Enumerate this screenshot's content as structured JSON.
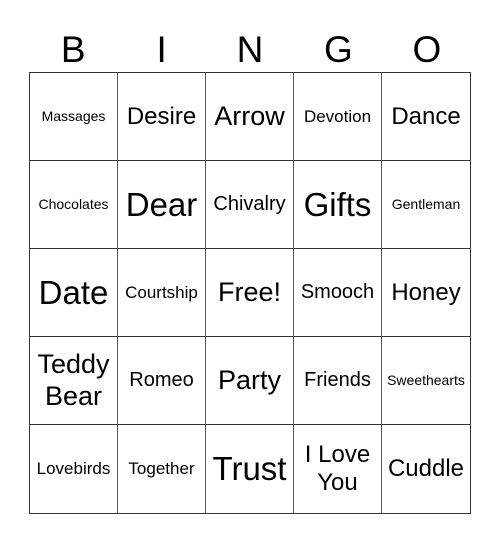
{
  "header": {
    "letters": [
      "B",
      "I",
      "N",
      "G",
      "O"
    ]
  },
  "card": {
    "cells": [
      {
        "text": "Massages",
        "size": "xs"
      },
      {
        "text": "Desire",
        "size": "l"
      },
      {
        "text": "Arrow",
        "size": "xl"
      },
      {
        "text": "Devotion",
        "size": "s"
      },
      {
        "text": "Dance",
        "size": "l"
      },
      {
        "text": "Chocolates",
        "size": "xs"
      },
      {
        "text": "Dear",
        "size": "xxl"
      },
      {
        "text": "Chivalry",
        "size": "m"
      },
      {
        "text": "Gifts",
        "size": "xxl"
      },
      {
        "text": "Gentleman",
        "size": "xs"
      },
      {
        "text": "Date",
        "size": "xxl"
      },
      {
        "text": "Courtship",
        "size": "s"
      },
      {
        "text": "Free!",
        "size": "xl"
      },
      {
        "text": "Smooch",
        "size": "m"
      },
      {
        "text": "Honey",
        "size": "l"
      },
      {
        "text": "Teddy\nBear",
        "size": "xl"
      },
      {
        "text": "Romeo",
        "size": "m"
      },
      {
        "text": "Party",
        "size": "xl"
      },
      {
        "text": "Friends",
        "size": "m"
      },
      {
        "text": "Sweethearts",
        "size": "xs"
      },
      {
        "text": "Lovebirds",
        "size": "s"
      },
      {
        "text": "Together",
        "size": "s"
      },
      {
        "text": "Trust",
        "size": "xxl"
      },
      {
        "text": "I Love\nYou",
        "size": "l"
      },
      {
        "text": "Cuddle",
        "size": "l"
      }
    ]
  }
}
